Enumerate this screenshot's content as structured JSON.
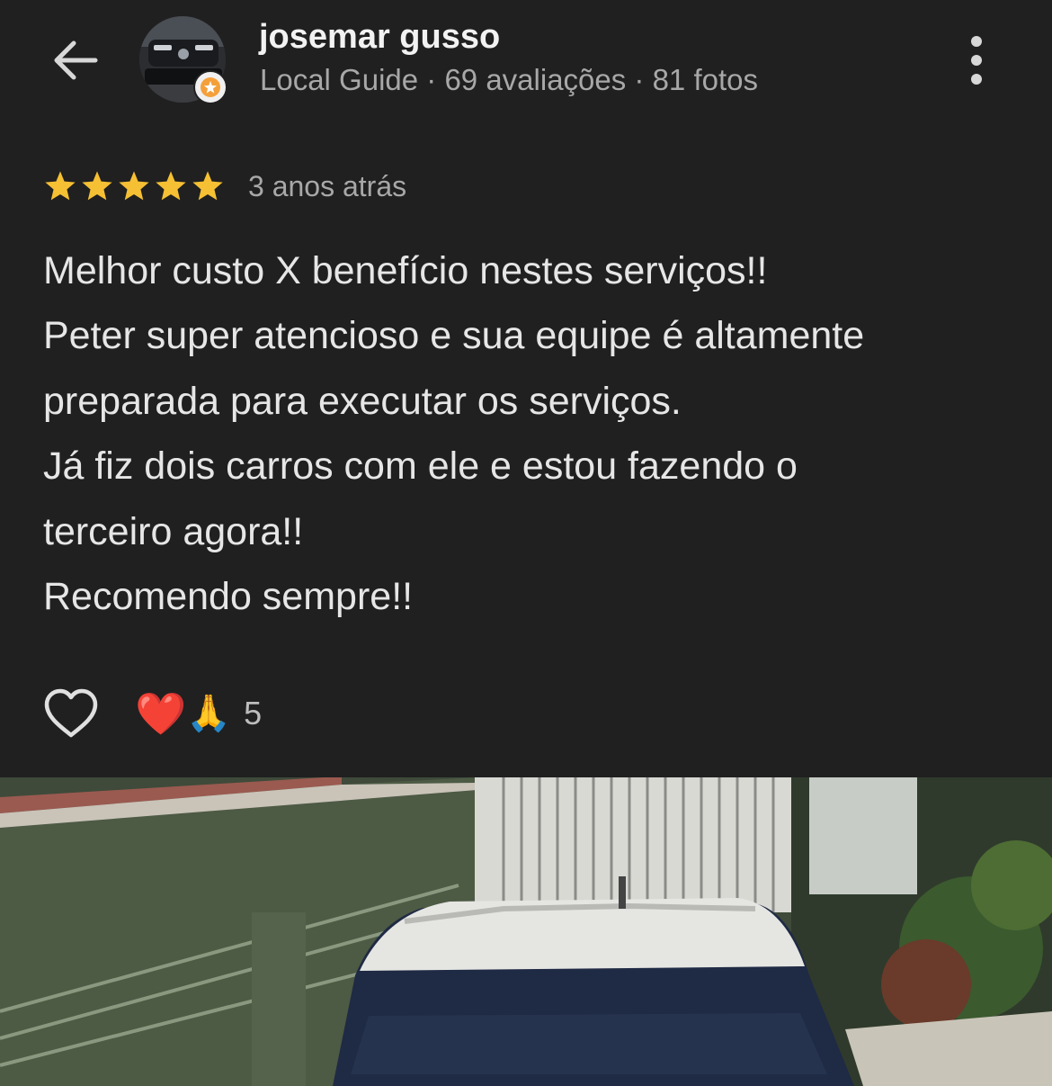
{
  "user": {
    "name": "josemar gusso",
    "meta": "Local Guide · 69 avaliações · 81 fotos",
    "rating_stars": 5,
    "rating_max": 5,
    "star_color": "#f5c033"
  },
  "review": {
    "date": "3 anos atrás",
    "lines": [
      "Melhor custo X benefício nestes serviços!!",
      "Peter super atencioso e sua equipe é altamente",
      "preparada para executar os serviços.",
      "Já fiz dois carros com ele e estou fazendo o",
      "terceiro agora!!",
      "Recomendo sempre!!"
    ]
  },
  "reactions": {
    "emoji_heart": "❤️",
    "emoji_pray": "🙏",
    "count": "5"
  },
  "icons": {
    "back": "arrow-left-icon",
    "more": "more-vert-icon",
    "like": "heart-outline-icon",
    "badge": "local-guide-star-icon"
  }
}
